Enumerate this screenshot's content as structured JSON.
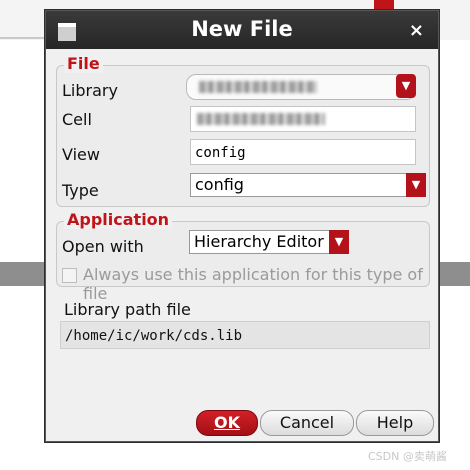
{
  "window": {
    "title": "New File",
    "close_glyph": "×"
  },
  "file_group": {
    "title": "File",
    "library_label": "Library",
    "cell_label": "Cell",
    "view_label": "View",
    "view_value": "config",
    "type_label": "Type",
    "type_value": "config"
  },
  "application_group": {
    "title": "Application",
    "open_with_label": "Open with",
    "open_with_value": "Hierarchy Editor",
    "always_use_label": "Always use this application for this type of file"
  },
  "library_path": {
    "label": "Library path file",
    "value": "/home/ic/work/cds.lib"
  },
  "buttons": {
    "ok": "OK",
    "cancel": "Cancel",
    "help": "Help"
  },
  "watermark": "CSDN @卖萌酱",
  "colors": {
    "accent": "#c0141b",
    "titlebar": "#2e2e2e"
  },
  "icons": [
    "window-menu-icon",
    "close-icon",
    "dropdown-arrow-icon"
  ]
}
